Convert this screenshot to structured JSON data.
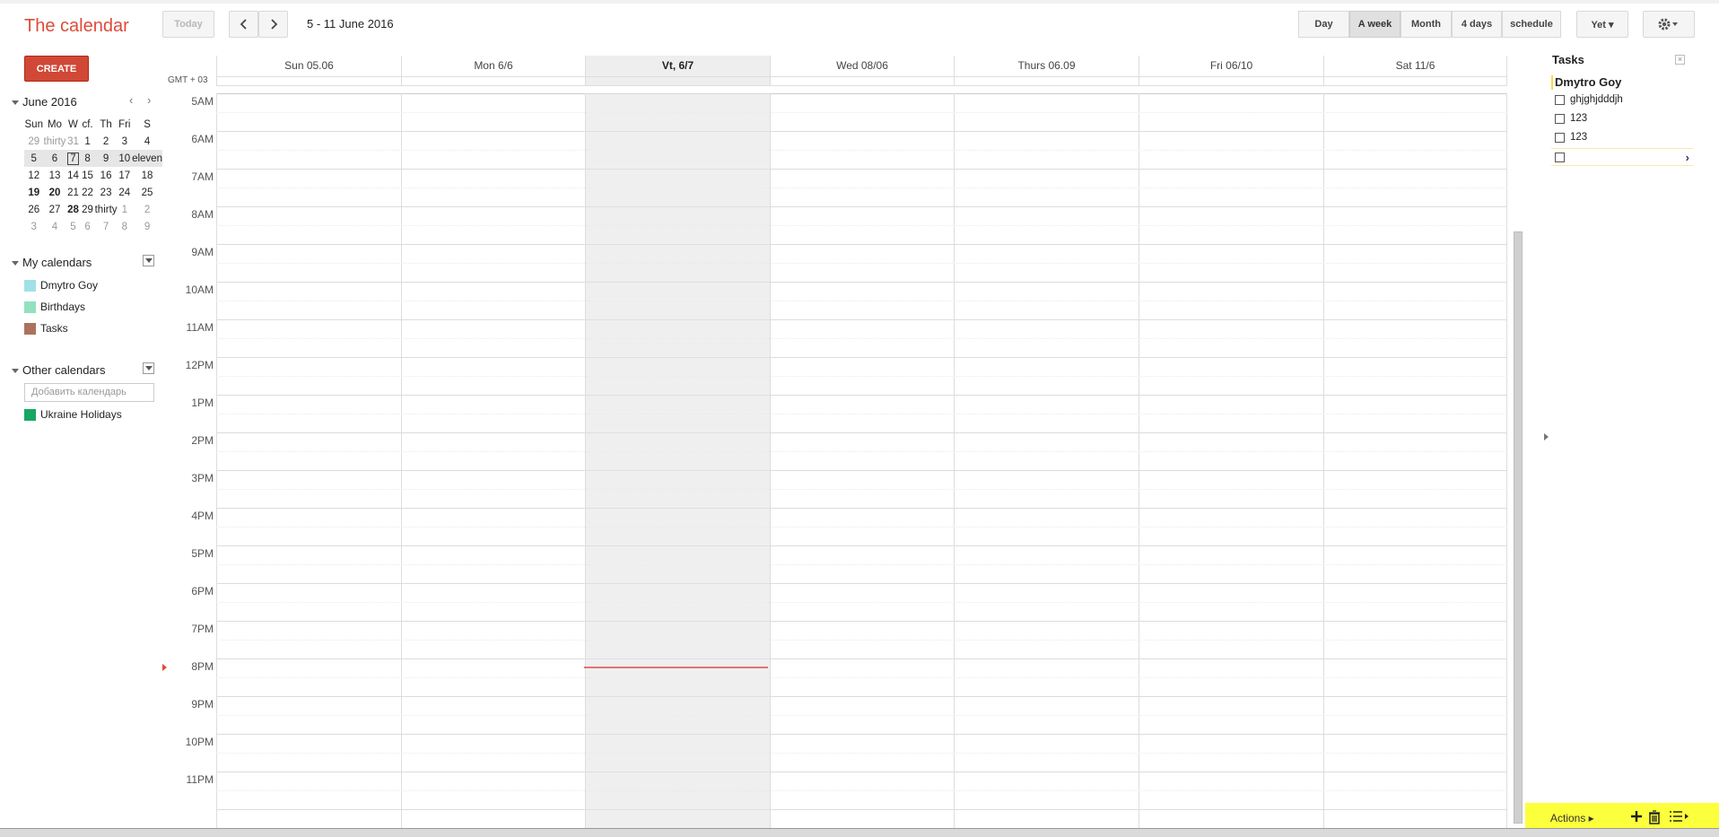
{
  "header": {
    "title": "The calendar",
    "today_label": "Today",
    "date_range": "5 - 11 June 2016",
    "views": [
      "Day",
      "A week",
      "Month",
      "4 days",
      "schedule"
    ],
    "active_view": "A week",
    "more_label": "Yet ▾"
  },
  "sidebar": {
    "create_label": "CREATE",
    "mini_calendar": {
      "month_label": "June 2016",
      "weekdays": [
        "Sun",
        "Mo",
        "W",
        "cf.",
        "Th",
        "Fri",
        "S"
      ],
      "weeks": [
        [
          "29",
          "thirty",
          "31",
          "1",
          "2",
          "3",
          "4"
        ],
        [
          "5",
          "6",
          "7",
          "8",
          "9",
          "10",
          "eleven"
        ],
        [
          "12",
          "13",
          "14",
          "15",
          "16",
          "17",
          "18"
        ],
        [
          "19",
          "20",
          "21",
          "22",
          "23",
          "24",
          "25"
        ],
        [
          "26",
          "27",
          "28",
          "29",
          "thirty",
          "1",
          "2"
        ],
        [
          "3",
          "4",
          "5",
          "6",
          "7",
          "8",
          "9"
        ]
      ]
    },
    "my_calendars": {
      "label": "My calendars",
      "items": [
        {
          "name": "Dmytro Goy",
          "color": "#9fe1e7"
        },
        {
          "name": "Birthdays",
          "color": "#92e1c0"
        },
        {
          "name": "Tasks",
          "color": "#ac725e"
        }
      ]
    },
    "other_calendars": {
      "label": "Other calendars",
      "add_placeholder": "Добавить календарь",
      "items": [
        {
          "name": "Ukraine Holidays",
          "color": "#16a765"
        }
      ]
    }
  },
  "grid": {
    "timezone": "GMT + 03",
    "days": [
      "Sun 05.06",
      "Mon 6/6",
      "Vt, 6/7",
      "Wed 08/06",
      "Thurs 06.09",
      "Fri 06/10",
      "Sat 11/6"
    ],
    "today_index": 2,
    "hours": [
      "5AM",
      "6AM",
      "7AM",
      "8AM",
      "9AM",
      "10AM",
      "11AM",
      "12PM",
      "1PM",
      "2PM",
      "3PM",
      "4PM",
      "5PM",
      "6PM",
      "7PM",
      "8PM",
      "9PM",
      "10PM",
      "11PM"
    ]
  },
  "tasks": {
    "title": "Tasks",
    "list_name": "Dmytro Goy",
    "items": [
      "ghjghjdddjh",
      "123",
      "123"
    ],
    "actions_label": "Actions ▸",
    "highlight_color": "#fcff3c"
  }
}
